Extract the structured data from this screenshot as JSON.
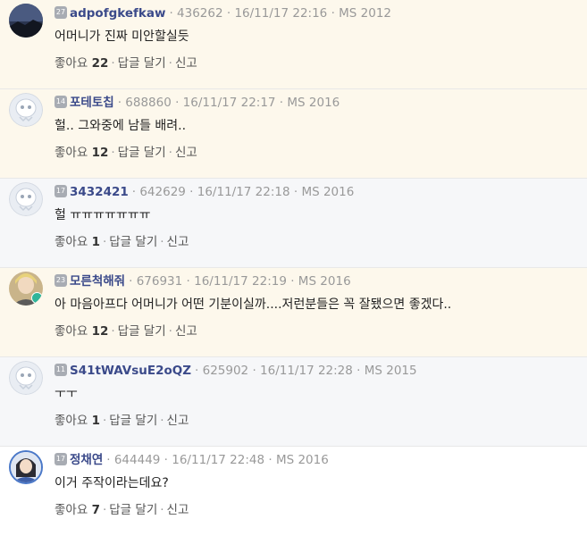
{
  "comments": [
    {
      "level": "27",
      "nick": "adpofgkefkaw",
      "meta": "· 436262 · 16/11/17 22:16 · MS 2012",
      "text": "어머니가 진짜 미안할실듯",
      "like": "좋아요",
      "count": "22",
      "reply": "답글 달기",
      "report": "신고",
      "avatar_icon": "night-landscape-avatar",
      "bg": "#fdf8ec"
    },
    {
      "level": "14",
      "nick": "포테토칩",
      "meta": "· 688860 · 16/11/17 22:17 · MS 2016",
      "text": "헐.. 그와중에 남들 배려..",
      "like": "좋아요",
      "count": "12",
      "reply": "답글 달기",
      "report": "신고",
      "avatar_icon": "default-face-avatar",
      "bg": "#fdf8ec"
    },
    {
      "level": "17",
      "nick": "3432421",
      "meta": "· 642629 · 16/11/17 22:18 · MS 2016",
      "text": "헐 ㅠㅠㅠㅠㅠㅠㅠ",
      "like": "좋아요",
      "count": "1",
      "reply": "답글 달기",
      "report": "신고",
      "avatar_icon": "default-face-avatar",
      "bg": "#f6f7f9"
    },
    {
      "level": "23",
      "nick": "모른척해줘",
      "meta": "· 676931 · 16/11/17 22:19 · MS 2016",
      "text": "아 마음아프다 어머니가 어떤 기분이실까....저런분들은 꼭 잘됐으면 좋겠다..",
      "like": "좋아요",
      "count": "12",
      "reply": "답글 달기",
      "report": "신고",
      "avatar_icon": "photo-avatar",
      "bg": "#fdf8ec"
    },
    {
      "level": "11",
      "nick": "S41tWAVsuE2oQZ",
      "meta": "· 625902 · 16/11/17 22:28 · MS 2015",
      "text": "ㅜㅜ",
      "like": "좋아요",
      "count": "1",
      "reply": "답글 달기",
      "report": "신고",
      "avatar_icon": "default-face-avatar",
      "bg": "#f6f7f9"
    },
    {
      "level": "17",
      "nick": "정채연",
      "meta": "· 644449 · 16/11/17 22:48 · MS 2016",
      "text": "이거 주작이라는데요?",
      "like": "좋아요",
      "count": "7",
      "reply": "답글 달기",
      "report": "신고",
      "avatar_icon": "photo-avatar",
      "bg": "#ffffff"
    }
  ]
}
